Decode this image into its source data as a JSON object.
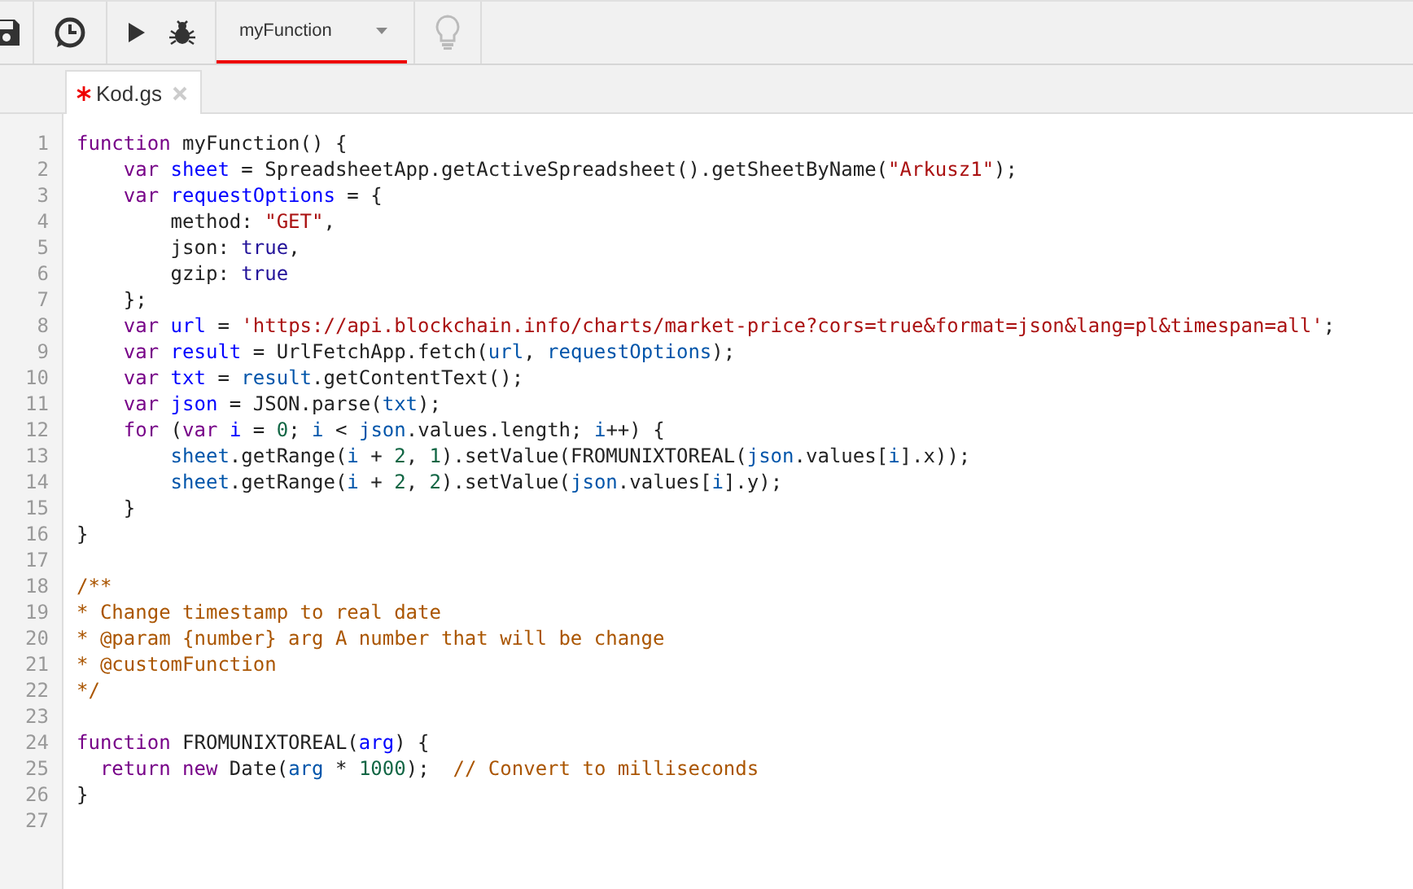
{
  "toolbar": {
    "function_select": {
      "value": "myFunction"
    },
    "hint_disabled": true
  },
  "tabs": [
    {
      "label": "Kod.gs",
      "selected": true,
      "unsaved": true
    }
  ],
  "editor": {
    "lines": [
      {
        "number": "1",
        "tokens": [
          {
            "kind": "keyword",
            "text": "function"
          },
          {
            "kind": "plain",
            "text": " myFunction() {"
          }
        ]
      },
      {
        "number": "2",
        "tokens": [
          {
            "kind": "keyword",
            "text": "    var"
          },
          {
            "kind": "def",
            "text": " sheet"
          },
          {
            "kind": "plain",
            "text": " = SpreadsheetApp.getActiveSpreadsheet().getSheetByName("
          },
          {
            "kind": "string",
            "text": "\"Arkusz1\""
          },
          {
            "kind": "plain",
            "text": ");"
          }
        ]
      },
      {
        "number": "3",
        "tokens": [
          {
            "kind": "keyword",
            "text": "    var"
          },
          {
            "kind": "def",
            "text": " requestOptions"
          },
          {
            "kind": "plain",
            "text": " = {"
          }
        ]
      },
      {
        "number": "4",
        "tokens": [
          {
            "kind": "plain",
            "text": "        method: "
          },
          {
            "kind": "string",
            "text": "\"GET\""
          },
          {
            "kind": "plain",
            "text": ","
          }
        ]
      },
      {
        "number": "5",
        "tokens": [
          {
            "kind": "plain",
            "text": "        json: "
          },
          {
            "kind": "atom",
            "text": "true"
          },
          {
            "kind": "plain",
            "text": ","
          }
        ]
      },
      {
        "number": "6",
        "tokens": [
          {
            "kind": "plain",
            "text": "        gzip: "
          },
          {
            "kind": "atom",
            "text": "true"
          }
        ]
      },
      {
        "number": "7",
        "tokens": [
          {
            "kind": "plain",
            "text": "    };"
          }
        ]
      },
      {
        "number": "8",
        "tokens": [
          {
            "kind": "keyword",
            "text": "    var"
          },
          {
            "kind": "def",
            "text": " url"
          },
          {
            "kind": "plain",
            "text": " = "
          },
          {
            "kind": "string",
            "text": "'https://api.blockchain.info/charts/market-price?cors=true&format=json&lang=pl&timespan=all'"
          },
          {
            "kind": "plain",
            "text": ";"
          }
        ]
      },
      {
        "number": "9",
        "tokens": [
          {
            "kind": "keyword",
            "text": "    var"
          },
          {
            "kind": "def",
            "text": " result"
          },
          {
            "kind": "plain",
            "text": " = UrlFetchApp.fetch("
          },
          {
            "kind": "variable",
            "text": "url"
          },
          {
            "kind": "plain",
            "text": ", "
          },
          {
            "kind": "variable",
            "text": "requestOptions"
          },
          {
            "kind": "plain",
            "text": ");"
          }
        ]
      },
      {
        "number": "10",
        "tokens": [
          {
            "kind": "keyword",
            "text": "    var"
          },
          {
            "kind": "def",
            "text": " txt"
          },
          {
            "kind": "plain",
            "text": " = "
          },
          {
            "kind": "variable",
            "text": "result"
          },
          {
            "kind": "plain",
            "text": ".getContentText();"
          }
        ]
      },
      {
        "number": "11",
        "tokens": [
          {
            "kind": "keyword",
            "text": "    var"
          },
          {
            "kind": "def",
            "text": " json"
          },
          {
            "kind": "plain",
            "text": " = JSON.parse("
          },
          {
            "kind": "variable",
            "text": "txt"
          },
          {
            "kind": "plain",
            "text": ");"
          }
        ]
      },
      {
        "number": "12",
        "tokens": [
          {
            "kind": "keyword",
            "text": "    for"
          },
          {
            "kind": "plain",
            "text": " ("
          },
          {
            "kind": "keyword",
            "text": "var"
          },
          {
            "kind": "def",
            "text": " i"
          },
          {
            "kind": "plain",
            "text": " = "
          },
          {
            "kind": "number",
            "text": "0"
          },
          {
            "kind": "plain",
            "text": "; "
          },
          {
            "kind": "variable",
            "text": "i"
          },
          {
            "kind": "plain",
            "text": " < "
          },
          {
            "kind": "variable",
            "text": "json"
          },
          {
            "kind": "plain",
            "text": ".values.length; "
          },
          {
            "kind": "variable",
            "text": "i"
          },
          {
            "kind": "plain",
            "text": "++) {"
          }
        ]
      },
      {
        "number": "13",
        "tokens": [
          {
            "kind": "variable",
            "text": "        sheet"
          },
          {
            "kind": "plain",
            "text": ".getRange("
          },
          {
            "kind": "variable",
            "text": "i"
          },
          {
            "kind": "plain",
            "text": " + "
          },
          {
            "kind": "number",
            "text": "2"
          },
          {
            "kind": "plain",
            "text": ", "
          },
          {
            "kind": "number",
            "text": "1"
          },
          {
            "kind": "plain",
            "text": ").setValue(FROMUNIXTOREAL("
          },
          {
            "kind": "variable",
            "text": "json"
          },
          {
            "kind": "plain",
            "text": ".values["
          },
          {
            "kind": "variable",
            "text": "i"
          },
          {
            "kind": "plain",
            "text": "].x));"
          }
        ]
      },
      {
        "number": "14",
        "tokens": [
          {
            "kind": "variable",
            "text": "        sheet"
          },
          {
            "kind": "plain",
            "text": ".getRange("
          },
          {
            "kind": "variable",
            "text": "i"
          },
          {
            "kind": "plain",
            "text": " + "
          },
          {
            "kind": "number",
            "text": "2"
          },
          {
            "kind": "plain",
            "text": ", "
          },
          {
            "kind": "number",
            "text": "2"
          },
          {
            "kind": "plain",
            "text": ").setValue("
          },
          {
            "kind": "variable",
            "text": "json"
          },
          {
            "kind": "plain",
            "text": ".values["
          },
          {
            "kind": "variable",
            "text": "i"
          },
          {
            "kind": "plain",
            "text": "].y);"
          }
        ]
      },
      {
        "number": "15",
        "tokens": [
          {
            "kind": "plain",
            "text": "    }"
          }
        ]
      },
      {
        "number": "16",
        "tokens": [
          {
            "kind": "plain",
            "text": "}"
          }
        ]
      },
      {
        "number": "17"
      },
      {
        "number": "18",
        "tokens": [
          {
            "kind": "comment",
            "text": "/**"
          }
        ]
      },
      {
        "number": "19",
        "tokens": [
          {
            "kind": "comment",
            "text": "* Change timestamp to real date"
          }
        ]
      },
      {
        "number": "20",
        "tokens": [
          {
            "kind": "comment",
            "text": "* @param {number} arg A number that will be change"
          }
        ]
      },
      {
        "number": "21",
        "tokens": [
          {
            "kind": "comment",
            "text": "* @customFunction"
          }
        ]
      },
      {
        "number": "22",
        "tokens": [
          {
            "kind": "comment",
            "text": "*/"
          }
        ]
      },
      {
        "number": "23"
      },
      {
        "number": "24",
        "tokens": [
          {
            "kind": "keyword",
            "text": "function"
          },
          {
            "kind": "plain",
            "text": " FROMUNIXTOREAL("
          },
          {
            "kind": "def",
            "text": "arg"
          },
          {
            "kind": "plain",
            "text": ") {"
          }
        ]
      },
      {
        "number": "25",
        "tokens": [
          {
            "kind": "keyword",
            "text": "  return"
          },
          {
            "kind": "keyword",
            "text": " new"
          },
          {
            "kind": "plain",
            "text": " Date("
          },
          {
            "kind": "variable",
            "text": "arg"
          },
          {
            "kind": "plain",
            "text": " * "
          },
          {
            "kind": "number",
            "text": "1000"
          },
          {
            "kind": "plain",
            "text": ");  "
          },
          {
            "kind": "comment",
            "text": "// Convert to milliseconds"
          }
        ]
      },
      {
        "number": "26",
        "tokens": [
          {
            "kind": "plain",
            "text": "}"
          }
        ]
      },
      {
        "number": "27"
      }
    ]
  }
}
